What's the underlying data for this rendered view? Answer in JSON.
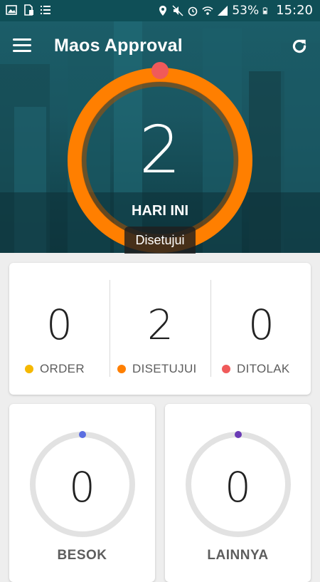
{
  "status_bar": {
    "battery": "53%",
    "time": "15:20"
  },
  "header": {
    "title": "Maos Approval",
    "menu_icon": "hamburger-menu-icon",
    "refresh_icon": "refresh-icon"
  },
  "today": {
    "count": "2",
    "caption": "HARI INI",
    "tooltip": "Disetujui",
    "ring_color": "#ff7f00",
    "marker_color": "#f05a5a"
  },
  "summary": {
    "order": {
      "value": "0",
      "label": "ORDER",
      "color": "#f5b800"
    },
    "approved": {
      "value": "2",
      "label": "DISETUJUI",
      "color": "#ff7f00"
    },
    "rejected": {
      "value": "0",
      "label": "DITOLAK",
      "color": "#f05a5a"
    }
  },
  "tomorrow": {
    "value": "0",
    "label": "BESOK",
    "marker_color": "#5b6ee1"
  },
  "others": {
    "value": "0",
    "label": "LAINNYA",
    "marker_color": "#6a3bb5"
  }
}
